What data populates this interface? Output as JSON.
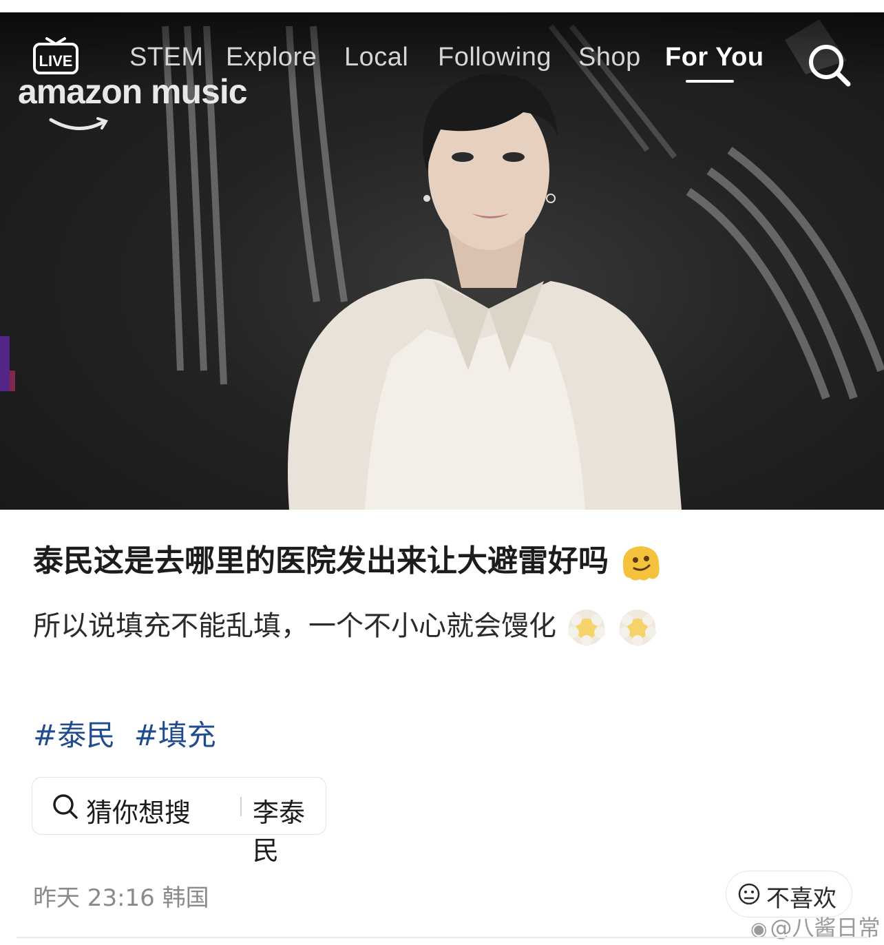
{
  "video": {
    "nav": {
      "live_label": "LIVE",
      "items": [
        "STEM",
        "Explore",
        "Local",
        "Following",
        "Shop",
        "For You"
      ],
      "active_tab": "For You"
    },
    "overlay_brand": "amazon music"
  },
  "post": {
    "title": "泰民这是去哪里的医院发出来让大避雷好吗",
    "title_emoji": "melting-face",
    "body": "所以说填充不能乱填，一个不小心就会馒化",
    "body_emojis": [
      "face-in-clouds",
      "face-in-clouds"
    ],
    "tags": [
      "#泰民",
      "#填充"
    ],
    "suggest": {
      "label": "猜你想搜",
      "keyword": "李泰民"
    },
    "meta": {
      "time": "昨天 23:16",
      "location": "韩国"
    },
    "dislike_label": "不喜欢",
    "watermark": "@八酱日常"
  },
  "colors": {
    "tag": "#1f4b8f",
    "meta": "#8a8a8a",
    "title": "#1c1c1c"
  }
}
